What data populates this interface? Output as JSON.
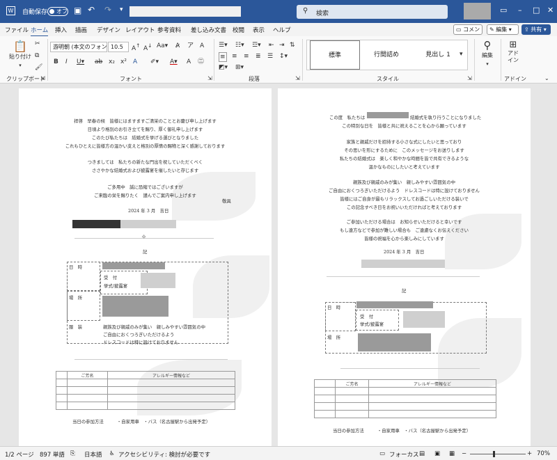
{
  "title_bar": {
    "autosave": "自動保存",
    "autosave_state": "オフ",
    "search_placeholder": "検索"
  },
  "tabs": [
    "ファイル",
    "ホーム",
    "挿入",
    "描画",
    "デザイン",
    "レイアウト",
    "参考資料",
    "差し込み文書",
    "校閲",
    "表示",
    "ヘルプ"
  ],
  "active_tab": "ホーム",
  "header_buttons": {
    "comment": "コメント",
    "edit": "編集",
    "share": "共有"
  },
  "ribbon": {
    "paste": "貼り付け",
    "clipboard_label": "クリップボード",
    "font_name": "游明朝 (本文のフォン",
    "font_size": "10.5",
    "font_label": "フォント",
    "paragraph_label": "段落",
    "styles": [
      "標準",
      "行間詰め",
      "見出し 1"
    ],
    "styles_label": "スタイル",
    "editing": "編集",
    "addin": "アド イン",
    "addin_label": "アドイン"
  },
  "page1": {
    "greeting": [
      "拝啓　早春の候　皆様にはますますご清栄のこととお慶び申し上げます",
      "日頃より格別のお引き立てを賜り、厚く御礼申し上げます",
      "このたび私たちは　結婚式を挙げる運びとなりました",
      "これもひとえに皆様方の温かい支えと格別の厚情の賜物と深く感謝しております",
      "つきましては　私たちの新たな門出を祝していただくべく",
      "ささやかな結婚式および披露宴を催したいと存じます",
      "ご多用中　誠に恐縮ではございますが",
      "ご来臨の栄を賜りたく　謹んでご案内申し上げます"
    ],
    "closing": "敬具",
    "date": "2024 年 3 月　吉日",
    "ki": "記",
    "rows": {
      "date_label": "日　時",
      "reception": "受　付",
      "ceremony": "挙式/披露宴",
      "venue_label": "場　所",
      "attire_label": "服　装"
    },
    "attire": [
      "親族及び親戚のみが集い　親しみやすい雰囲気の中",
      "ご自由におくつろぎいただけるよう",
      "ドレスコードは特に設けておりません"
    ],
    "table_headers": [
      "ご芳名",
      "アレルギー情報など"
    ],
    "attendance": "当日の参加方法　　　・自家用車　・バス（名古屋駅から出発予定）"
  },
  "page2": {
    "body": [
      "この度　私たちは",
      "結婚式を執り行うことになりました",
      "この特別な日を　皆様と共に祝えることを心から願っています",
      "家族と親戚だけを招待する小さな式にしたいと思っており",
      "その思いを形にするために　このメッセージをお送りします",
      "私たちの結婚式は　楽しく和やかな時間を皆で共有できるような",
      "温かなものにしたいと考えています",
      "親族及び親戚のみが集い　親しみやすい雰囲気の中",
      "ご自由におくつろぎいただけるよう　ドレスコードは特に設けておりません",
      "皆様にはご自身が最もリラックスしてお過ごしいただける装いで",
      "この記念すべき日をお祝いいただければと考えております",
      "ご参加いただける場合は　お知らせいただけると幸いです",
      "もし遠方などで参加が難しい場合も　ご遠慮なくお伝えください",
      "皆様の祝福を心から楽しみにしています"
    ],
    "date": "2024 年 3 月　吉日",
    "ki": "記",
    "rows": {
      "date_label": "日　時",
      "reception": "受　付",
      "ceremony": "挙式/披露宴",
      "venue_label": "場　所"
    },
    "table_headers": [
      "ご芳名",
      "アレルギー情報など"
    ],
    "attendance": "当日の参加方法　　　・自家用車　・バス（名古屋駅から出発予定）"
  },
  "status": {
    "page": "1/2 ページ",
    "words": "897 単語",
    "lang": "日本語",
    "accessibility": "アクセシビリティ: 検討が必要です",
    "focus": "フォーカス",
    "zoom": "70%"
  }
}
